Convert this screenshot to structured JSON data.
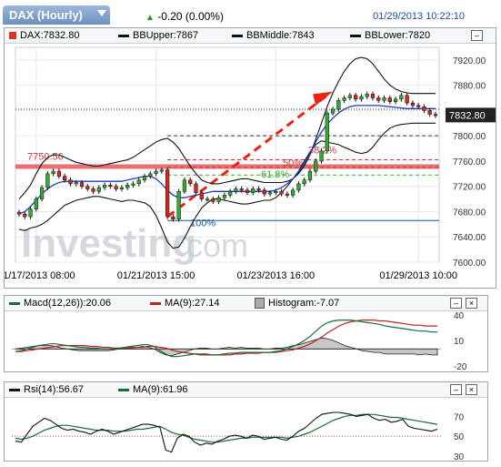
{
  "header": {
    "instrument": "DAX (Hourly)",
    "change": "-0.20 (0.00%)",
    "timestamp": "01/29/2013 10:22:10"
  },
  "main_legend": {
    "price": "DAX:7832.80",
    "bb_upper": "BBUpper:7867",
    "bb_middle": "BBMiddle:7843",
    "bb_lower": "BBLower:7820"
  },
  "main_chart": {
    "y_ticks": [
      "7920.00",
      "7880.00",
      "7840.00",
      "7800.00",
      "7760.00",
      "7720.00",
      "7680.00",
      "7640.00",
      "7600.00"
    ],
    "x_ticks": [
      "01/17/2013 08:00",
      "01/21/2013 15:00",
      "01/23/2013 16:00",
      "01/29/2013 10:00"
    ],
    "current_price": "7832.80",
    "resistance_label": "7750.56",
    "fib_labels": [
      "38.2%",
      "50%",
      "61.8%",
      "100%"
    ],
    "watermark_left": "Investing",
    "watermark_right": ".com"
  },
  "macd_legend": {
    "macd": "Macd(12,26)):20.06",
    "ma": "MA(9):27.14",
    "hist": "Histogram:-7.07",
    "y_ticks": [
      "40",
      "10",
      "-20"
    ]
  },
  "rsi_legend": {
    "rsi": "Rsi(14):56.67",
    "ma": "MA(9):61.96",
    "y_ticks": [
      "70",
      "50",
      "30"
    ]
  },
  "chart_data": [
    {
      "type": "candlestick",
      "title": "DAX (Hourly)",
      "ylim": [
        7600,
        7940
      ],
      "series": [
        {
          "name": "DAX",
          "values": [
            7676,
            7672,
            7684,
            7700,
            7718,
            7740,
            7744,
            7736,
            7730,
            7724,
            7726,
            7720,
            7716,
            7712,
            7718,
            7722,
            7720,
            7716,
            7718,
            7722,
            7724,
            7730,
            7736,
            7740,
            7744,
            7746,
            7672,
            7668,
            7712,
            7730,
            7724,
            7710,
            7700,
            7700,
            7696,
            7702,
            7706,
            7712,
            7716,
            7714,
            7710,
            7716,
            7714,
            7708,
            7710,
            7712,
            7708,
            7706,
            7714,
            7724,
            7730,
            7744,
            7760,
            7776,
            7836,
            7842,
            7856,
            7860,
            7864,
            7858,
            7862,
            7866,
            7860,
            7856,
            7860,
            7854,
            7858,
            7864,
            7852,
            7848,
            7846,
            7840,
            7834,
            7832
          ]
        },
        {
          "name": "BBUpper",
          "values": [
            7700,
            7710,
            7722,
            7740,
            7756,
            7766,
            7770,
            7770,
            7766,
            7762,
            7758,
            7756,
            7754,
            7752,
            7752,
            7754,
            7756,
            7758,
            7760,
            7762,
            7766,
            7772,
            7778,
            7784,
            7790,
            7794,
            7796,
            7790,
            7780,
            7766,
            7752,
            7740,
            7730,
            7726,
            7724,
            7724,
            7726,
            7728,
            7730,
            7732,
            7732,
            7730,
            7728,
            7726,
            7726,
            7726,
            7726,
            7728,
            7732,
            7740,
            7752,
            7770,
            7794,
            7820,
            7846,
            7868,
            7886,
            7902,
            7914,
            7922,
            7924,
            7922,
            7914,
            7902,
            7890,
            7880,
            7874,
            7870,
            7868,
            7867,
            7867,
            7867,
            7867,
            7867
          ]
        },
        {
          "name": "BBMiddle",
          "values": [
            7676,
            7680,
            7688,
            7698,
            7708,
            7716,
            7722,
            7726,
            7728,
            7728,
            7728,
            7728,
            7728,
            7728,
            7728,
            7728,
            7728,
            7728,
            7728,
            7730,
            7732,
            7734,
            7736,
            7736,
            7732,
            7724,
            7714,
            7706,
            7702,
            7702,
            7704,
            7706,
            7708,
            7710,
            7712,
            7712,
            7712,
            7712,
            7712,
            7712,
            7712,
            7712,
            7712,
            7712,
            7712,
            7714,
            7718,
            7724,
            7732,
            7742,
            7756,
            7772,
            7790,
            7806,
            7818,
            7828,
            7836,
            7842,
            7846,
            7848,
            7848,
            7848,
            7848,
            7848,
            7847,
            7846,
            7845,
            7844,
            7843,
            7843,
            7843,
            7843,
            7843,
            7843
          ]
        },
        {
          "name": "BBLower",
          "values": [
            7652,
            7650,
            7654,
            7656,
            7660,
            7666,
            7674,
            7682,
            7690,
            7694,
            7698,
            7700,
            7702,
            7704,
            7704,
            7702,
            7700,
            7698,
            7696,
            7698,
            7698,
            7696,
            7694,
            7688,
            7674,
            7654,
            7632,
            7622,
            7624,
            7638,
            7656,
            7672,
            7686,
            7694,
            7700,
            7700,
            7698,
            7696,
            7694,
            7692,
            7692,
            7694,
            7696,
            7698,
            7698,
            7702,
            7710,
            7720,
            7732,
            7744,
            7760,
            7774,
            7786,
            7792,
            7790,
            7788,
            7786,
            7782,
            7778,
            7774,
            7772,
            7774,
            7782,
            7794,
            7804,
            7812,
            7816,
            7818,
            7819,
            7820,
            7820,
            7820,
            7820,
            7820
          ]
        }
      ]
    },
    {
      "type": "line",
      "title": "MACD",
      "ylim": [
        -20,
        40
      ],
      "series": [
        {
          "name": "Macd(12,26))",
          "values": [
            -3,
            -2,
            0,
            2,
            4,
            5,
            6,
            6,
            5,
            4,
            3,
            2,
            2,
            1,
            1,
            0,
            0,
            0,
            1,
            2,
            3,
            4,
            5,
            5,
            3,
            -2,
            -6,
            -9,
            -9,
            -8,
            -7,
            -6,
            -6,
            -6,
            -7,
            -7,
            -6,
            -5,
            -5,
            -4,
            -4,
            -4,
            -4,
            -4,
            -4,
            -3,
            -2,
            0,
            3,
            6,
            10,
            15,
            21,
            27,
            31,
            33,
            34,
            34,
            34,
            33,
            32,
            31,
            30,
            29,
            27,
            26,
            25,
            24,
            23,
            22,
            21,
            21,
            20,
            20
          ]
        },
        {
          "name": "MA(9)",
          "values": [
            -3,
            -3,
            -2,
            -1,
            0,
            1,
            2,
            3,
            4,
            4,
            4,
            4,
            4,
            3,
            3,
            2,
            2,
            1,
            1,
            1,
            1,
            2,
            2,
            3,
            3,
            2,
            1,
            -1,
            -3,
            -4,
            -5,
            -6,
            -7,
            -7,
            -7,
            -7,
            -7,
            -7,
            -6,
            -6,
            -5,
            -5,
            -5,
            -4,
            -4,
            -4,
            -3,
            -2,
            -1,
            1,
            3,
            6,
            10,
            14,
            19,
            23,
            27,
            30,
            32,
            33,
            34,
            34,
            34,
            33,
            33,
            32,
            31,
            30,
            29,
            28,
            28,
            27,
            27,
            27
          ]
        },
        {
          "name": "Histogram",
          "values": [
            0,
            1,
            2,
            3,
            4,
            4,
            4,
            3,
            1,
            0,
            -1,
            -2,
            -2,
            -2,
            -2,
            -2,
            -2,
            -1,
            0,
            1,
            2,
            2,
            3,
            2,
            0,
            -4,
            -7,
            -8,
            -6,
            -4,
            -2,
            0,
            1,
            1,
            0,
            0,
            1,
            2,
            1,
            2,
            1,
            1,
            1,
            0,
            0,
            1,
            1,
            2,
            4,
            5,
            7,
            9,
            11,
            13,
            12,
            10,
            7,
            4,
            2,
            0,
            -2,
            -3,
            -4,
            -4,
            -6,
            -6,
            -6,
            -6,
            -6,
            -6,
            -7,
            -6,
            -7,
            -7
          ]
        }
      ]
    },
    {
      "type": "line",
      "title": "RSI",
      "ylim": [
        30,
        85
      ],
      "series": [
        {
          "name": "Rsi(14)",
          "values": [
            45,
            44,
            52,
            60,
            64,
            68,
            66,
            62,
            58,
            56,
            57,
            55,
            54,
            52,
            55,
            57,
            55,
            52,
            54,
            56,
            58,
            60,
            62,
            62,
            61,
            59,
            36,
            34,
            48,
            52,
            50,
            44,
            41,
            43,
            42,
            45,
            47,
            50,
            51,
            50,
            48,
            51,
            50,
            47,
            48,
            49,
            47,
            46,
            50,
            55,
            58,
            63,
            68,
            72,
            73,
            74,
            74,
            73,
            72,
            70,
            71,
            72,
            68,
            66,
            67,
            64,
            65,
            67,
            60,
            58,
            57,
            56,
            55,
            57
          ]
        },
        {
          "name": "MA(9)",
          "values": [
            48,
            47,
            48,
            50,
            53,
            56,
            58,
            60,
            61,
            61,
            60,
            59,
            58,
            57,
            56,
            56,
            56,
            55,
            55,
            55,
            56,
            57,
            57,
            58,
            59,
            60,
            57,
            54,
            52,
            51,
            49,
            47,
            46,
            45,
            44,
            44,
            45,
            46,
            47,
            48,
            48,
            49,
            49,
            49,
            49,
            49,
            49,
            48,
            49,
            50,
            52,
            54,
            57,
            60,
            63,
            66,
            68,
            70,
            71,
            71,
            72,
            72,
            72,
            71,
            70,
            69,
            69,
            68,
            67,
            66,
            65,
            64,
            63,
            62
          ]
        }
      ]
    }
  ]
}
